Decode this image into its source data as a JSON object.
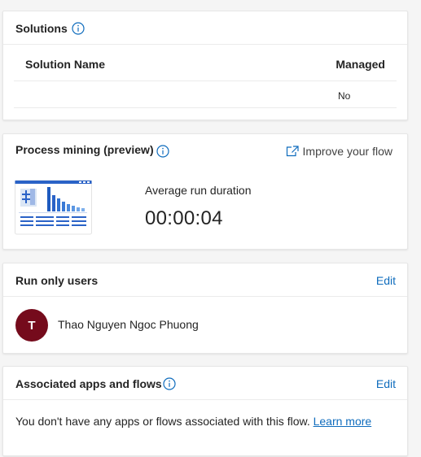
{
  "solutions": {
    "title": "Solutions",
    "columns": {
      "name": "Solution Name",
      "managed": "Managed"
    },
    "rows": [
      {
        "name": "",
        "managed": "No"
      }
    ]
  },
  "process_mining": {
    "title": "Process mining (preview)",
    "improve_label": "Improve your flow",
    "metric_label": "Average run duration",
    "metric_value": "00:00:04"
  },
  "run_only_users": {
    "title": "Run only users",
    "edit_label": "Edit",
    "users": [
      {
        "initial": "T",
        "name": "Thao Nguyen Ngoc Phuong",
        "avatar_color": "#750b1c"
      }
    ]
  },
  "associated": {
    "title": "Associated apps and flows",
    "edit_label": "Edit",
    "message": "You don't have any apps or flows associated with this flow.",
    "learn_more": "Learn more"
  },
  "colors": {
    "accent": "#0f6cbd",
    "text": "#242424",
    "divider": "#ebebeb"
  },
  "icons": [
    "info-icon",
    "open-external-icon",
    "process-mining-illustration"
  ]
}
